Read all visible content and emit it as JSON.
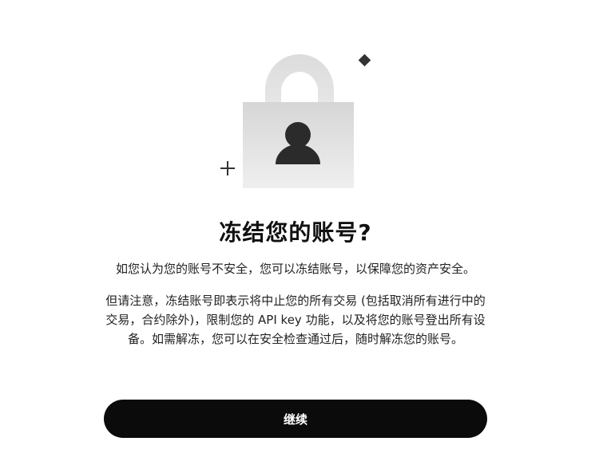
{
  "dialog": {
    "title": "冻结您的账号?",
    "subtitle": "如您认为您的账号不安全，您可以冻结账号，以保障您的资产安全。",
    "note": "但请注意，冻结账号即表示将中止您的所有交易 (包括取消所有进行中的交易，合约除外)，限制您的 API key 功能，以及将您的账号登出所有设备。如需解冻，您可以在安全检查通过后，随时解冻您的账号。",
    "continue_label": "继续"
  },
  "illustration": {
    "icon": "padlock-with-user-icon",
    "decor_icons": [
      "diamond-icon",
      "plus-icon"
    ],
    "colors": {
      "lock_body": "#e6e6e6",
      "shackle": "#d9d9d9",
      "person": "#2b2b2b",
      "decor": "#333333"
    }
  },
  "colors": {
    "button_bg": "#0b0b0b",
    "button_text": "#ffffff",
    "text": "#222222"
  }
}
